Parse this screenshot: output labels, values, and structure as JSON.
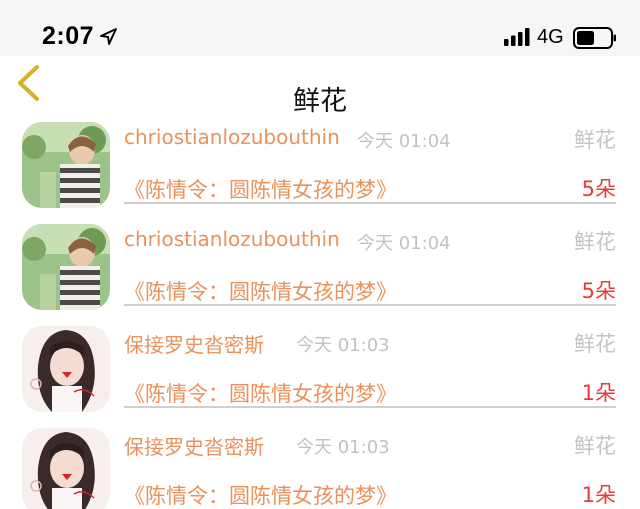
{
  "status_bar": {
    "time": "2:07",
    "network": "4G",
    "icons": [
      "location-arrow-icon",
      "signal-icon",
      "battery-icon"
    ]
  },
  "nav": {
    "title": "鲜花",
    "back_icon": "chevron-left-icon"
  },
  "colors": {
    "accent": "#e9925b",
    "count": "#e83b37",
    "muted": "#c2c2c2",
    "back": "#d9b02c"
  },
  "records": [
    {
      "name": "chriostianlozubouthin",
      "time": "今天 01:04",
      "type": "鲜花",
      "book": "《陈情令：圆陈情女孩的梦》",
      "count": "5朵"
    },
    {
      "name": "chriostianlozubouthin",
      "time": "今天 01:04",
      "type": "鲜花",
      "book": "《陈情令：圆陈情女孩的梦》",
      "count": "5朵"
    },
    {
      "name": "保接罗史沓密斯",
      "time": "今天 01:03",
      "type": "鲜花",
      "book": "《陈情令：圆陈情女孩的梦》",
      "count": "1朵"
    },
    {
      "name": "保接罗史沓密斯",
      "time": "今天 01:03",
      "type": "鲜花",
      "book": "《陈情令：圆陈情女孩的梦》",
      "count": "1朵"
    }
  ]
}
